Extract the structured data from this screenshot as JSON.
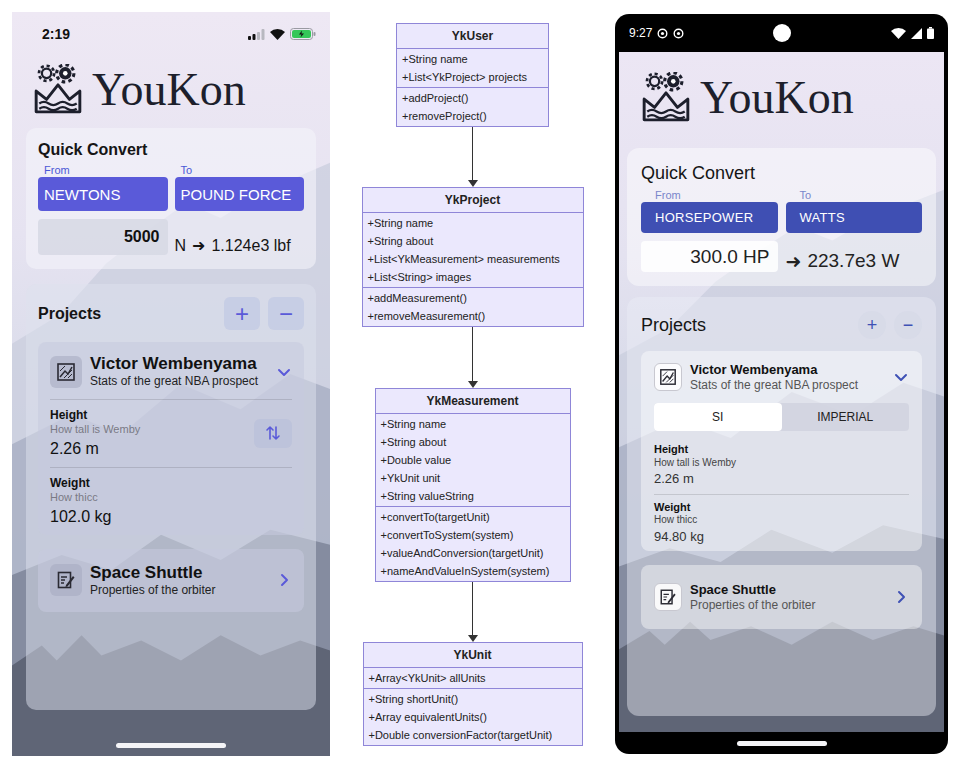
{
  "ios_app": {
    "status_bar": {
      "time": "2:19"
    },
    "logo": {
      "text": "YouKon"
    },
    "quick_convert": {
      "title": "Quick Convert",
      "from_label": "From",
      "to_label": "To",
      "from_unit": "NEWTONS",
      "to_unit": "POUND FORCE",
      "input": "5000",
      "input_unit": "N",
      "arrow": "➜",
      "result": "1.124e3 lbf"
    },
    "projects": {
      "title": "Projects",
      "add_button": "+",
      "remove_button": "−",
      "items": [
        {
          "name": "Victor Wembenyama",
          "about": "Stats of the great NBA prospect",
          "expanded": true,
          "measurements": [
            {
              "name": "Height",
              "about": "How tall is Wemby",
              "value": "2.26 m"
            },
            {
              "name": "Weight",
              "about": "How thicc",
              "value": "102.0 kg"
            }
          ]
        },
        {
          "name": "Space Shuttle",
          "about": "Properties of the orbiter",
          "expanded": false,
          "measurements": []
        }
      ]
    }
  },
  "class_diagram": {
    "classes": [
      {
        "name": "YkUser",
        "attributes": [
          "+String name",
          "+List<YkProject> projects"
        ],
        "methods": [
          "+addProject()",
          "+removeProject()"
        ]
      },
      {
        "name": "YkProject",
        "attributes": [
          "+String name",
          "+String about",
          "+List<YkMeasurement> measurements",
          "+List<String> images"
        ],
        "methods": [
          "+addMeasurement()",
          "+removeMeasurement()"
        ]
      },
      {
        "name": "YkMeasurement",
        "attributes": [
          "+String name",
          "+String about",
          "+Double value",
          "+YkUnit unit",
          "+String valueString"
        ],
        "methods": [
          "+convertTo(targetUnit)",
          "+convertToSystem(system)",
          "+valueAndConversion(targetUnit)",
          "+nameAndValueInSystem(system)"
        ]
      },
      {
        "name": "YkUnit",
        "attributes": [
          "+Array<YkUnit> allUnits"
        ],
        "methods": [
          "+String shortUnit()",
          "+Array equivalentUnits()",
          "+Double conversionFactor(targetUnit)"
        ]
      }
    ]
  },
  "android_app": {
    "status_bar": {
      "time": "9:27"
    },
    "logo": {
      "text": "YouKon"
    },
    "quick_convert": {
      "title": "Quick Convert",
      "from_label": "From",
      "to_label": "To",
      "from_unit": "HORSEPOWER",
      "to_unit": "WATTS",
      "input": "300.0 HP",
      "arrow": "➜",
      "result": "223.7e3 W"
    },
    "projects": {
      "title": "Projects",
      "add_button": "+",
      "remove_button": "−",
      "items": [
        {
          "name": "Victor Wembenyama",
          "about": "Stats of the great NBA prospect",
          "expanded": true,
          "systems": [
            {
              "label": "SI",
              "selected": true
            },
            {
              "label": "IMPERIAL",
              "selected": false
            }
          ],
          "measurements": [
            {
              "name": "Height",
              "about": "How tall is Wemby",
              "value": "2.26 m"
            },
            {
              "name": "Weight",
              "about": "How thicc",
              "value": "94.80 kg"
            }
          ]
        },
        {
          "name": "Space Shuttle",
          "about": "Properties of the orbiter",
          "expanded": false,
          "systems": [],
          "measurements": []
        }
      ]
    }
  }
}
